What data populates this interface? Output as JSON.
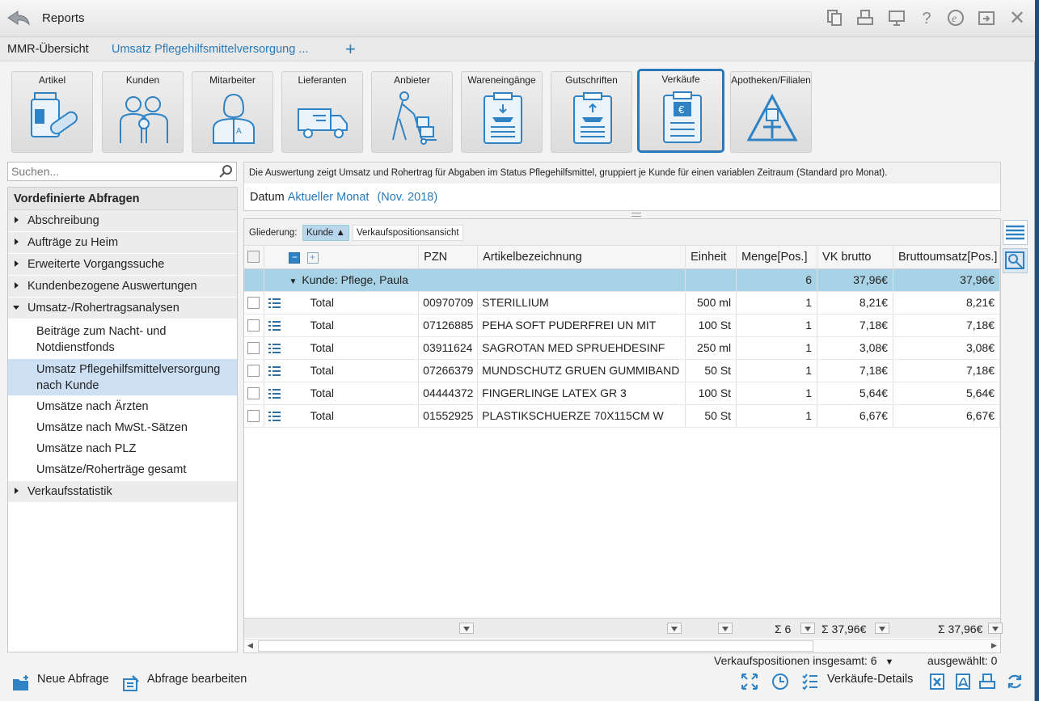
{
  "window": {
    "title": "Reports"
  },
  "tabs": [
    {
      "label": "MMR-Übersicht"
    },
    {
      "label": "Umsatz Pflegehilfsmittelversorgung ..."
    }
  ],
  "tiles": [
    {
      "label": "Artikel",
      "icon": "medicine-bottle-icon"
    },
    {
      "label": "Kunden",
      "icon": "family-icon"
    },
    {
      "label": "Mitarbeiter",
      "icon": "pharmacist-icon"
    },
    {
      "label": "Lieferanten",
      "icon": "delivery-truck-icon"
    },
    {
      "label": "Anbieter",
      "icon": "hand-truck-icon"
    },
    {
      "label": "Wareneingänge",
      "icon": "clipboard-in-icon"
    },
    {
      "label": "Gutschriften",
      "icon": "clipboard-out-icon"
    },
    {
      "label": "Verkäufe",
      "icon": "clipboard-euro-icon"
    },
    {
      "label": "Apotheken/Filialen",
      "icon": "pharmacy-icon"
    }
  ],
  "search": {
    "placeholder": "Suchen..."
  },
  "left": {
    "heading": "Vordefinierte Abfragen",
    "groups": [
      "Abschreibung",
      "Aufträge zu Heim",
      "Erweiterte Vorgangssuche",
      "Kundenbezogene Auswertungen",
      "Umsatz-/Rohertragsanalysen",
      "Verkaufsstatistik"
    ],
    "subitems": [
      "Beiträge zum Nacht- und Notdienstfonds",
      "Umsatz Pflegehilfsmittelversorgung nach Kunde",
      "Umsätze nach Ärzten",
      "Umsätze nach MwSt.-Sätzen",
      "Umsätze nach PLZ",
      "Umsätze/Roherträge gesamt"
    ]
  },
  "description": "Die Auswertung zeigt Umsatz und Rohertrag für Abgaben im Status Pflegehilfsmittel, gruppiert je Kunde für einen variablen Zeitraum (Standard pro Monat).",
  "datum": {
    "label": "Datum",
    "value": "Aktueller Monat",
    "period": "(Nov. 2018)"
  },
  "gliederung": {
    "label": "Gliederung:",
    "chip1": "Kunde",
    "chip2": "Verkaufspositionsansicht"
  },
  "columns": [
    "PZN",
    "Artikelbezeichnung",
    "Einheit",
    "Menge[Pos.]",
    "VK brutto",
    "Bruttoumsatz[Pos.]"
  ],
  "group": {
    "label": "Kunde: Pflege, Paula",
    "menge": "6",
    "vk": "37,96€",
    "umsatz": "37,96€"
  },
  "rows": [
    {
      "type": "Total",
      "pzn": "00970709",
      "name": "STERILLIUM",
      "einheit": "500 ml",
      "menge": "1",
      "vk": "8,21€",
      "umsatz": "8,21€"
    },
    {
      "type": "Total",
      "pzn": "07126885",
      "name": "PEHA SOFT PUDERFREI UN MIT",
      "einheit": "100 St",
      "menge": "1",
      "vk": "7,18€",
      "umsatz": "7,18€"
    },
    {
      "type": "Total",
      "pzn": "03911624",
      "name": "SAGROTAN MED SPRUEHDESINF",
      "einheit": "250 ml",
      "menge": "1",
      "vk": "3,08€",
      "umsatz": "3,08€"
    },
    {
      "type": "Total",
      "pzn": "07266379",
      "name": "MUNDSCHUTZ GRUEN GUMMIBAND",
      "einheit": "50 St",
      "menge": "1",
      "vk": "7,18€",
      "umsatz": "7,18€"
    },
    {
      "type": "Total",
      "pzn": "04444372",
      "name": "FINGERLINGE LATEX GR 3",
      "einheit": "100 St",
      "menge": "1",
      "vk": "5,64€",
      "umsatz": "5,64€"
    },
    {
      "type": "Total",
      "pzn": "01552925",
      "name": "PLASTIKSCHUERZE 70X115CM W",
      "einheit": "50 St",
      "menge": "1",
      "vk": "6,67€",
      "umsatz": "6,67€"
    }
  ],
  "footer": {
    "menge": "Σ 6",
    "vk": "Σ 37,96€",
    "umsatz": "Σ 37,96€"
  },
  "status": {
    "total": "Verkaufspositionen insgesamt: 6",
    "selected": "ausgewählt: 0"
  },
  "bottom": {
    "new_query": "Neue Abfrage",
    "edit_query": "Abfrage bearbeiten",
    "details": "Verkäufe-Details"
  },
  "colors": {
    "accent": "#2a7ab8",
    "group_row": "#a8d3e6",
    "selected_item": "#cde0f3"
  }
}
